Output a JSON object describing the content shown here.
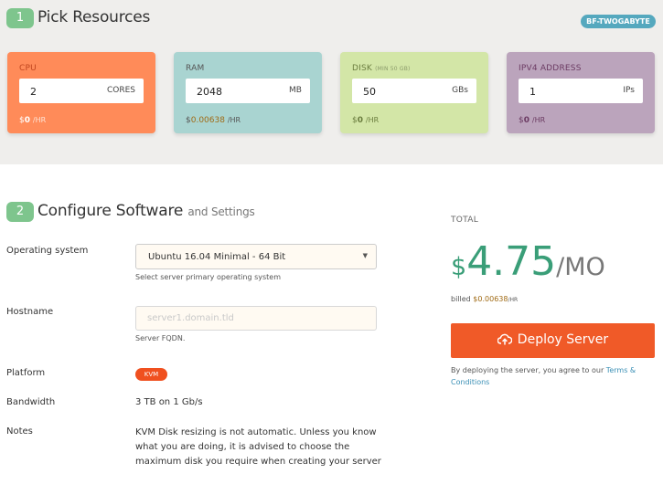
{
  "pick": {
    "step": "1",
    "title": "Pick Resources",
    "tag": "BF-TWOGABYTE"
  },
  "resources": [
    {
      "label": "CPU",
      "value": "2",
      "unit": "CORES",
      "price_prefix": "$",
      "price": "0",
      "per": "/HR"
    },
    {
      "label": "RAM",
      "value": "2048",
      "unit": "MB",
      "price_prefix": "$",
      "price": "0.00638",
      "per": "/HR"
    },
    {
      "label": "DISK",
      "hint": "(MIN 50 GB)",
      "value": "50",
      "unit": "GBs",
      "price_prefix": "$",
      "price": "0",
      "per": "/HR"
    },
    {
      "label": "IPV4 ADDRESS",
      "value": "1",
      "unit": "IPs",
      "price_prefix": "$",
      "price": "0",
      "per": "/HR"
    }
  ],
  "configure": {
    "step": "2",
    "title": "Configure Software",
    "subtitle": "and Settings",
    "os": {
      "label": "Operating system",
      "selected": "Ubuntu 16.04 Minimal - 64 Bit",
      "help": "Select server primary operating system"
    },
    "hostname": {
      "label": "Hostname",
      "value": "",
      "placeholder": "server1.domain.tld",
      "help": "Server FQDN."
    },
    "platform": {
      "label": "Platform",
      "value": "KVM"
    },
    "bandwidth": {
      "label": "Bandwidth",
      "value": "3 TB on 1 Gb/s"
    },
    "notes": {
      "label": "Notes",
      "value": "KVM Disk resizing is not automatic. Unless you know what you are doing, it is advised to choose the maximum disk you require when creating your server"
    }
  },
  "total": {
    "label": "TOTAL",
    "currency": "$",
    "amount": "4.75",
    "period": "/MO",
    "billed_text": "billed",
    "billed_prefix": "$",
    "billed_amount": "0.00638",
    "billed_per": "/HR",
    "deploy_label": "Deploy Server",
    "deploy_icon": "cloud-upload-icon",
    "agree_text": "By deploying the server, you agree to our",
    "terms_link": "Terms & Conditions"
  },
  "colors": {
    "cpu": "#ff8b59",
    "ram": "#a9d4d1",
    "disk": "#d3e6a7",
    "ipv4": "#bba4bc",
    "accent": "#f05a28",
    "total": "#3a9e78",
    "step_badge": "#7ec58d",
    "tag": "#55a8be"
  }
}
